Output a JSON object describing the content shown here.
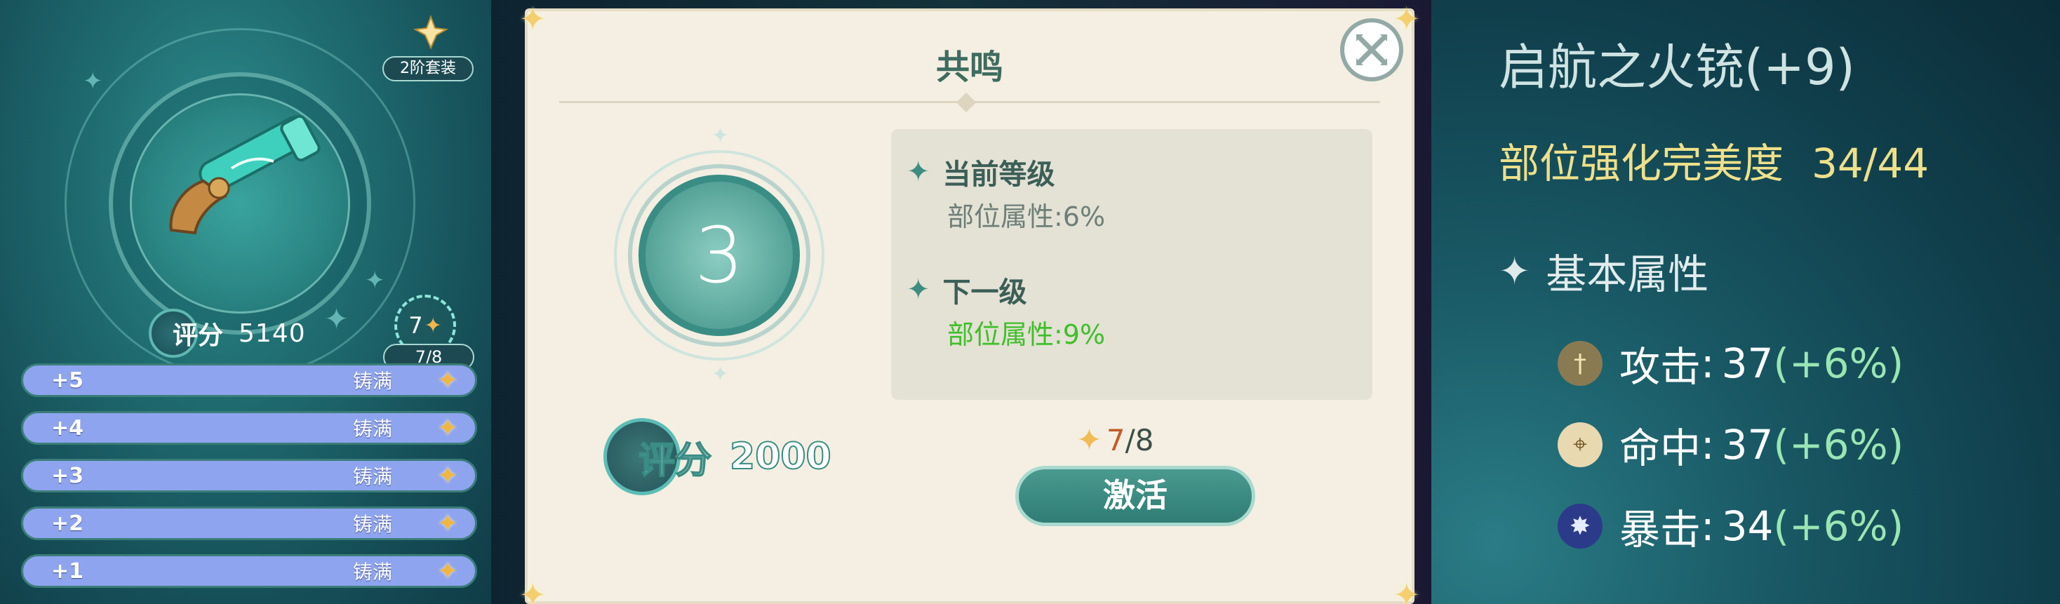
{
  "left": {
    "set_badge": "2阶套装",
    "score_label": "评分",
    "score_value": "5140",
    "star_count": "7",
    "star_progress": "7/8",
    "rows": [
      {
        "level": "+5",
        "status": "铸满"
      },
      {
        "level": "+4",
        "status": "铸满"
      },
      {
        "level": "+3",
        "status": "铸满"
      },
      {
        "level": "+2",
        "status": "铸满"
      },
      {
        "level": "+1",
        "status": "铸满"
      }
    ]
  },
  "dialog": {
    "title": "共鸣",
    "level": "3",
    "current_head": "当前等级",
    "current_value": "部位属性:6%",
    "next_head": "下一级",
    "next_value": "部位属性:9%",
    "score_label": "评分",
    "score_value": "2000",
    "req_current": "7",
    "req_total": "/8",
    "activate_label": "激活"
  },
  "right": {
    "title": "启航之火铳(+9)",
    "perfection_label": "部位强化完美度",
    "perfection_value": "34/44",
    "base_head": "基本属性",
    "attrs": [
      {
        "name": "攻击",
        "value": "37",
        "bonus": "(+6%)",
        "icon": "attack-icon"
      },
      {
        "name": "命中",
        "value": "37",
        "bonus": "(+6%)",
        "icon": "hit-icon"
      },
      {
        "name": "暴击",
        "value": "34",
        "bonus": "(+6%)",
        "icon": "crit-icon"
      }
    ]
  },
  "colors": {
    "accent_teal": "#3a8d84",
    "row_blue": "#8fa4ef",
    "star_gold": "#f1b640",
    "next_green": "#3fbf2a",
    "perfection_yellow": "#eee08a"
  }
}
